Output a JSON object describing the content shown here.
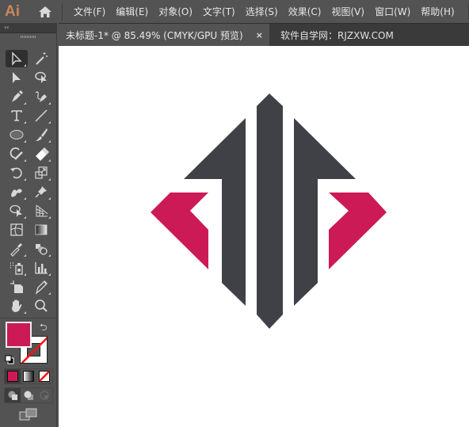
{
  "app": {
    "logo": "Ai",
    "logo_color": "#c9875a"
  },
  "menu": {
    "items": [
      {
        "label": "文件(F)"
      },
      {
        "label": "编辑(E)"
      },
      {
        "label": "对象(O)"
      },
      {
        "label": "文字(T)"
      },
      {
        "label": "选择(S)"
      },
      {
        "label": "效果(C)"
      },
      {
        "label": "视图(V)"
      },
      {
        "label": "窗口(W)"
      },
      {
        "label": "帮助(H)"
      }
    ]
  },
  "tabs": {
    "active": {
      "label": "未标题-1* @ 85.49% (CMYK/GPU 预览)",
      "close_icon": "×"
    },
    "other": {
      "label": "软件自学网：RJZXW.COM"
    }
  },
  "toolbar": {
    "collapse_label": "‹‹",
    "tools": [
      {
        "name": "selection-tool",
        "selected": true
      },
      {
        "name": "magic-wand-tool"
      },
      {
        "name": "direct-selection-tool"
      },
      {
        "name": "lasso-tool"
      },
      {
        "name": "pen-tool"
      },
      {
        "name": "curvature-tool"
      },
      {
        "name": "type-tool"
      },
      {
        "name": "line-segment-tool"
      },
      {
        "name": "ellipse-tool"
      },
      {
        "name": "paintbrush-tool"
      },
      {
        "name": "shaper-tool"
      },
      {
        "name": "eraser-tool"
      },
      {
        "name": "rotate-tool"
      },
      {
        "name": "scale-tool"
      },
      {
        "name": "puppet-warp-tool"
      },
      {
        "name": "pin-tool"
      },
      {
        "name": "shape-builder-tool"
      },
      {
        "name": "perspective-grid-tool"
      },
      {
        "name": "mesh-tool"
      },
      {
        "name": "gradient-tool"
      },
      {
        "name": "eyedropper-tool"
      },
      {
        "name": "blend-tool"
      },
      {
        "name": "symbol-sprayer-tool"
      },
      {
        "name": "column-graph-tool"
      },
      {
        "name": "artboard-tool"
      },
      {
        "name": "slice-tool"
      },
      {
        "name": "hand-tool"
      },
      {
        "name": "zoom-tool"
      }
    ],
    "fill_color": "#cc1a57",
    "stroke": "none",
    "swap_icon": "⮌"
  },
  "artwork": {
    "dark_color": "#404146",
    "accent_color": "#cc1a57",
    "background": "#ffffff"
  }
}
